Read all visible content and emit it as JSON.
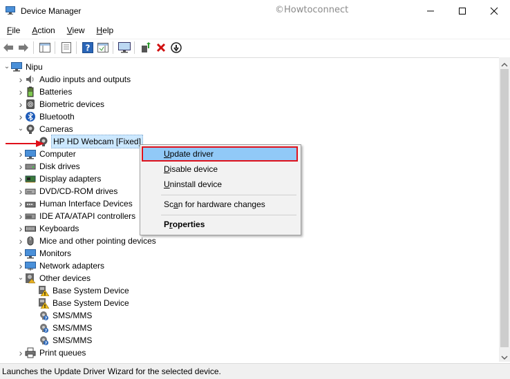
{
  "window": {
    "title": "Device Manager",
    "watermark": "©Howtoconnect"
  },
  "menu": [
    "File",
    "Action",
    "View",
    "Help"
  ],
  "menu_underline": [
    "F",
    "A",
    "V",
    "H"
  ],
  "tree": {
    "root": "Nipu",
    "items": [
      {
        "label": "Audio inputs and outputs",
        "icon": "speaker-icon"
      },
      {
        "label": "Batteries",
        "icon": "battery-icon"
      },
      {
        "label": "Biometric devices",
        "icon": "biometric-icon"
      },
      {
        "label": "Bluetooth",
        "icon": "bluetooth-icon"
      },
      {
        "label": "Cameras",
        "icon": "camera-icon"
      },
      {
        "label": "HP HD Webcam [Fixed]",
        "icon": "webcam-icon"
      },
      {
        "label": "Computer",
        "icon": "computer-icon"
      },
      {
        "label": "Disk drives",
        "icon": "disk-icon"
      },
      {
        "label": "Display adapters",
        "icon": "display-adapter-icon"
      },
      {
        "label": "DVD/CD-ROM drives",
        "icon": "dvd-icon"
      },
      {
        "label": "Human Interface Devices",
        "icon": "hid-icon"
      },
      {
        "label": "IDE ATA/ATAPI controllers",
        "icon": "ide-icon"
      },
      {
        "label": "Keyboards",
        "icon": "keyboard-icon"
      },
      {
        "label": "Mice and other pointing devices",
        "icon": "mouse-icon"
      },
      {
        "label": "Monitors",
        "icon": "monitor-icon"
      },
      {
        "label": "Network adapters",
        "icon": "network-icon"
      },
      {
        "label": "Other devices",
        "icon": "other-devices-icon"
      },
      {
        "label": "Base System Device",
        "icon": "warning-device-icon"
      },
      {
        "label": "Base System Device",
        "icon": "warning-device-icon"
      },
      {
        "label": "SMS/MMS",
        "icon": "unknown-device-icon"
      },
      {
        "label": "SMS/MMS",
        "icon": "unknown-device-icon"
      },
      {
        "label": "SMS/MMS",
        "icon": "unknown-device-icon"
      },
      {
        "label": "Print queues",
        "icon": "printer-icon"
      }
    ]
  },
  "context_menu": {
    "items": [
      "Update driver",
      "Disable device",
      "Uninstall device",
      "Scan for hardware changes",
      "Properties"
    ],
    "underline": [
      "U",
      "D",
      "U",
      "A",
      "R"
    ]
  },
  "status": "Launches the Update Driver Wizard for the selected device.",
  "colors": {
    "selection": "#cce8ff",
    "menu_highlight": "#91c9f7",
    "annotation_red": "#e0101a"
  }
}
